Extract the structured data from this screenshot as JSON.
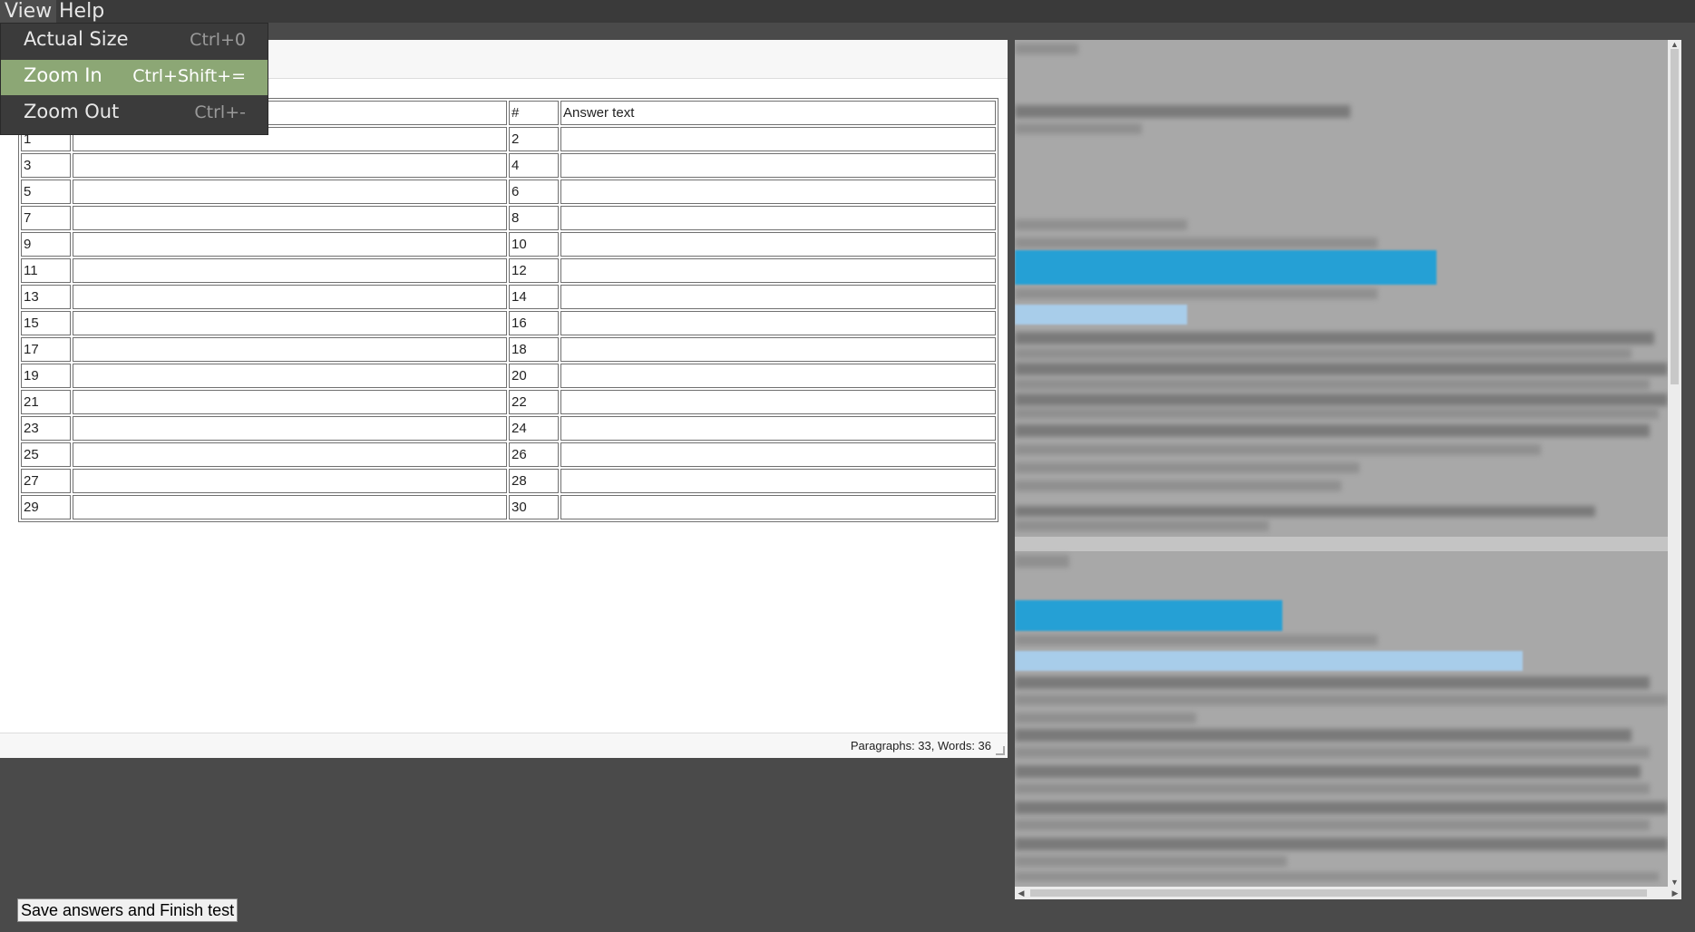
{
  "menubar": {
    "items": [
      {
        "label": "View"
      },
      {
        "label": "Help"
      }
    ]
  },
  "view_menu": {
    "items": [
      {
        "label": "Actual Size",
        "shortcut": "Ctrl+0"
      },
      {
        "label": "Zoom In",
        "shortcut": "Ctrl+Shift+="
      },
      {
        "label": "Zoom Out",
        "shortcut": "Ctrl+-"
      }
    ]
  },
  "answer_table": {
    "header": {
      "num_col": "#",
      "text_col": "Answer text"
    },
    "row_numbers": [
      [
        "1",
        "2"
      ],
      [
        "3",
        "4"
      ],
      [
        "5",
        "6"
      ],
      [
        "7",
        "8"
      ],
      [
        "9",
        "10"
      ],
      [
        "11",
        "12"
      ],
      [
        "13",
        "14"
      ],
      [
        "15",
        "16"
      ],
      [
        "17",
        "18"
      ],
      [
        "19",
        "20"
      ],
      [
        "21",
        "22"
      ],
      [
        "23",
        "24"
      ],
      [
        "25",
        "26"
      ],
      [
        "27",
        "28"
      ],
      [
        "29",
        "30"
      ]
    ]
  },
  "status": {
    "counts": "Paragraphs: 33, Words: 36"
  },
  "actions": {
    "finish_label": "Save answers and Finish test"
  }
}
